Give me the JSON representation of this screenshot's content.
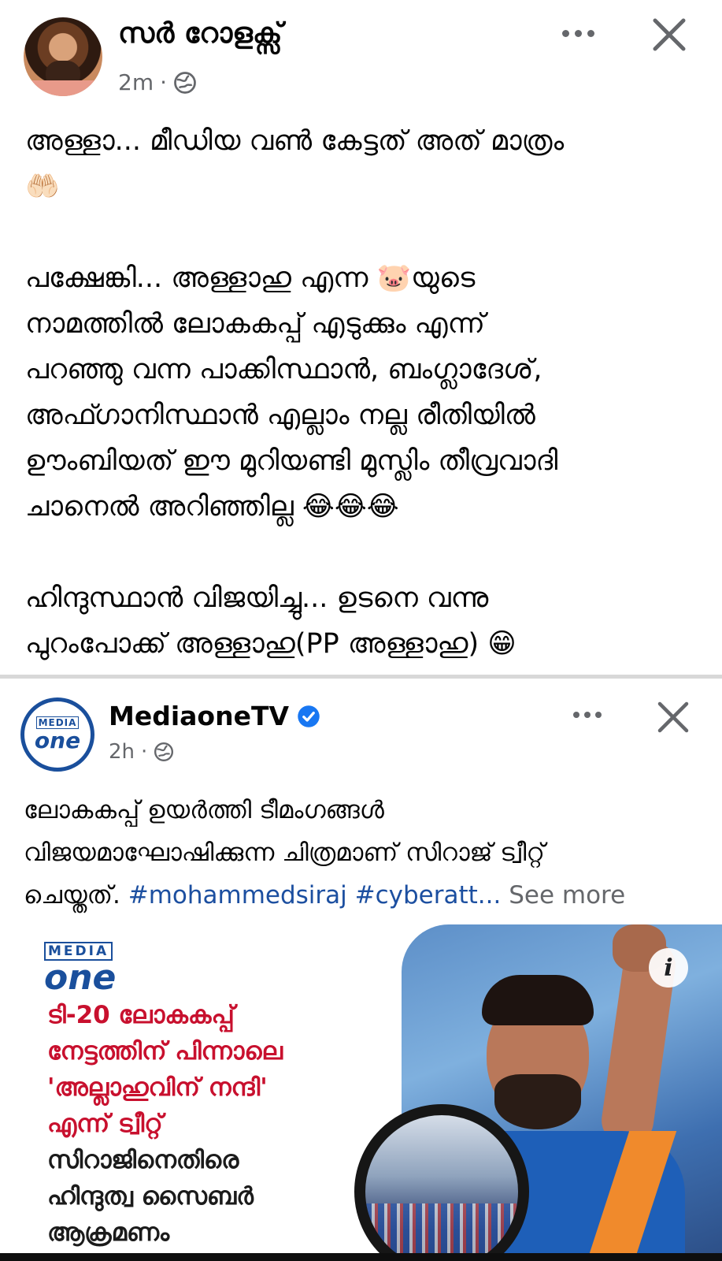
{
  "post": {
    "author": "സർ റോളക്സ്",
    "time": "2m",
    "separator": "·",
    "paragraphs": [
      "അള്ളാ... മീഡിയ വൺ കേട്ടത് അത് മാത്രം\n🤲🏻",
      "പക്ഷേങ്കി... അള്ളാഹു എന്ന 🐷യുടെ\nനാമത്തിൽ ലോകകപ്പ് എടുക്കും എന്ന്\nപറഞ്ഞു വന്ന പാക്കിസ്ഥാൻ, ബംഗ്ലാദേശ്,\nഅഫ്ഗാനിസ്ഥാൻ എല്ലാം നല്ല രീതിയിൽ\nഊംബിയത് ഈ മുറിയണ്ടി മുസ്ലിം തീവ്രവാദി\nചാനെൽ അറിഞ്ഞില്ല 😂😂😂",
      "ഹിന്ദുസ്ഥാൻ വിജയിച്ചു... ഉടനെ വന്നു\nപുറംപോക്ക് അള്ളാഹു(PP അള്ളാഹു) 😁"
    ]
  },
  "shared_post": {
    "page_name": "MediaoneTV",
    "time": "2h",
    "separator": "·",
    "avatar_text_top": "MEDIA",
    "avatar_text_bottom": "one",
    "text": "ലോകകപ്പ് ഉയർത്തി ടീമംഗങ്ങൾ\nവിജയമാഘോഷിക്കുന്ന ചിത്രമാണ് സിറാജ് ട്വീറ്റ്\nചെയ്തത്.",
    "hashtags": "#mohammedsiraj #cyberatt...",
    "see_more": "See more",
    "image": {
      "logo_top": "MEDIA",
      "logo_bottom": "one",
      "headline_red_1": "ടി-20 ലോകകപ്പ്",
      "headline_red_2": "നേട്ടത്തിന് പിന്നാലെ",
      "headline_red_3": "'അല്ലാഹുവിന് നന്ദി'",
      "headline_red_4": "എന്ന് ട്വീറ്റ്",
      "headline_dark_1": "സിറാജിനെതിരെ",
      "headline_dark_2": "ഹിന്ദുത്വ സൈബർ",
      "headline_dark_3": "ആക്രമണം",
      "info_glyph": "i"
    }
  },
  "colors": {
    "text_primary": "#050505",
    "text_secondary": "#65676b",
    "hashtag": "#1c4fa0",
    "brand_blue": "#1a4f9c",
    "headline_red": "#c8102e",
    "verified": "#1877f2"
  },
  "icons": [
    "globe-icon",
    "more-options-icon",
    "close-icon",
    "verified-badge-icon",
    "info-icon"
  ]
}
